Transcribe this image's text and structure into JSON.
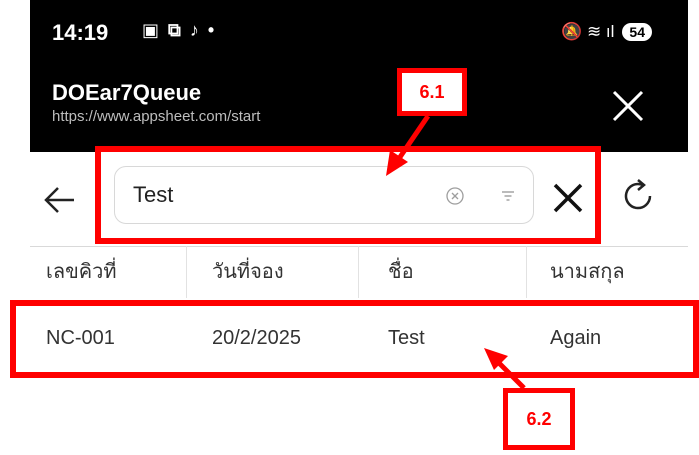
{
  "status_bar": {
    "time": "14:19",
    "left_icons": "▣ ⧉ ♪ •",
    "right_icons": "🔕 ≋ ıl",
    "battery": "54"
  },
  "app_header": {
    "title": "DOEar7Queue",
    "url": "https://www.appsheet.com/start"
  },
  "search": {
    "value": "Test"
  },
  "table": {
    "columns": [
      "เลขคิวที่",
      "วันที่จอง",
      "ชื่อ",
      "นามสกุล"
    ],
    "rows": [
      [
        "NC-001",
        "20/2/2025",
        "Test",
        "Again"
      ]
    ]
  },
  "annotations": {
    "callout_1": "6.1",
    "callout_2": "6.2"
  },
  "colors": {
    "highlight": "#ff0000",
    "header_bg": "#000000"
  }
}
